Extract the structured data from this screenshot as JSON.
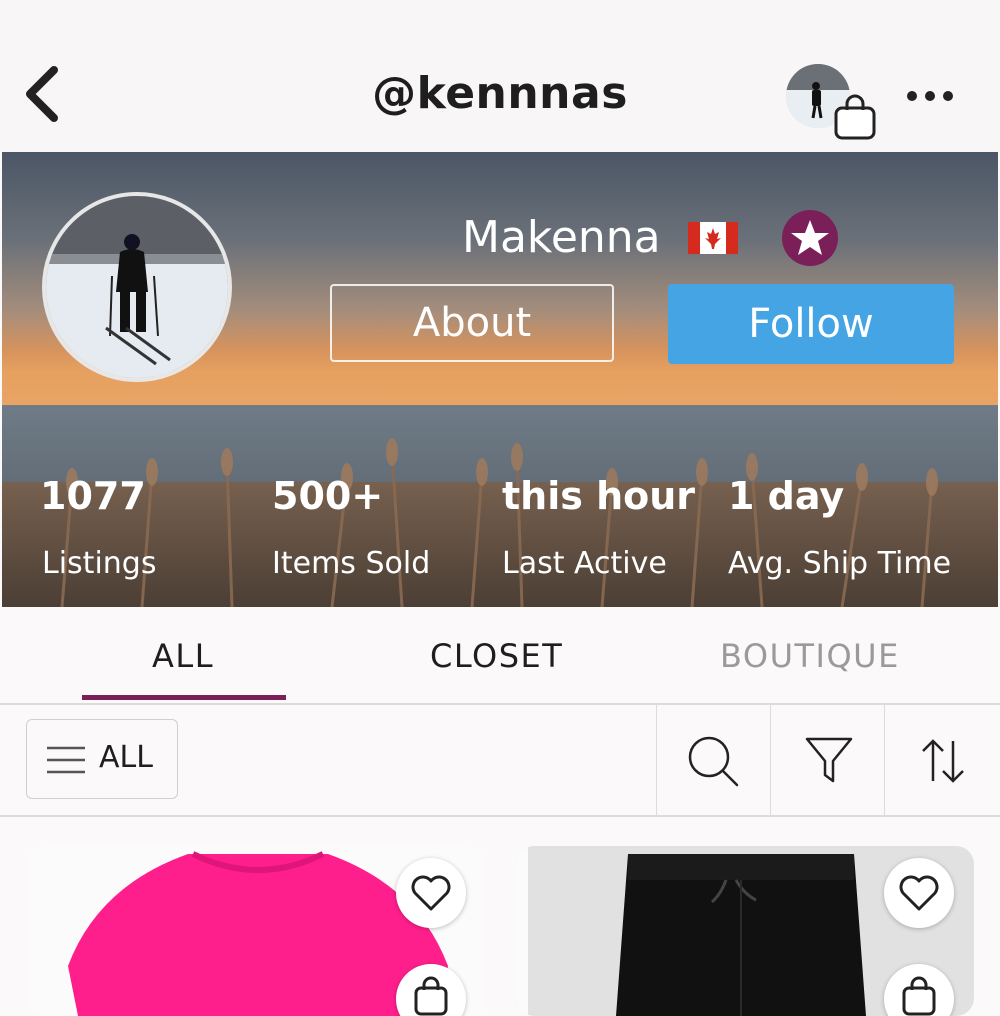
{
  "header": {
    "handle": "@kennnas",
    "icons": {
      "back": "chevron-left-icon",
      "bag": "shopping-bag-icon",
      "more": "more-horizontal-icon"
    }
  },
  "profile": {
    "display_name": "Makenna",
    "country_flag": "canada-flag-icon",
    "badge": "star-badge-icon",
    "about_label": "About",
    "follow_label": "Follow",
    "stats": [
      {
        "value": "1077",
        "label": "Listings"
      },
      {
        "value": "500+",
        "label": "Items Sold"
      },
      {
        "value": "this hour",
        "label": "Last Active"
      },
      {
        "value": "1 day",
        "label": "Avg. Ship Time"
      }
    ]
  },
  "tabs": [
    {
      "label": "ALL",
      "active": true
    },
    {
      "label": "CLOSET",
      "active": false
    },
    {
      "label": "BOUTIQUE",
      "active": false
    }
  ],
  "toolbar": {
    "filter_label": "ALL",
    "icons": [
      "menu-icon",
      "search-icon",
      "filter-icon",
      "sort-icon"
    ]
  },
  "colors": {
    "accent": "#7a1f58",
    "follow_button": "#45a4e4",
    "badge": "#7a1f58"
  }
}
